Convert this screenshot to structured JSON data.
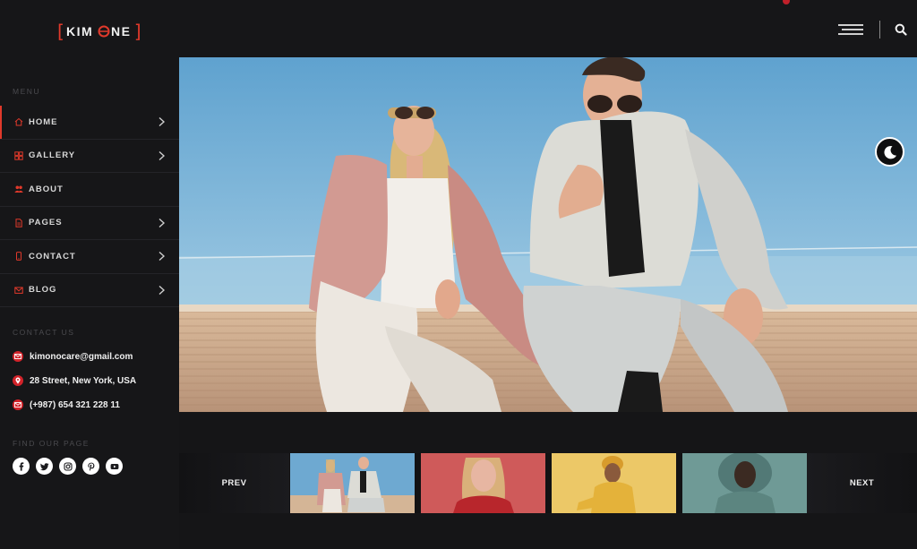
{
  "brand": {
    "logo_text": "KIMONE",
    "accent_color": "#e0392b"
  },
  "header": {
    "menu_icon": "hamburger-icon",
    "search_icon": "search-icon"
  },
  "sidebar": {
    "menu_title": "MENU",
    "items": [
      {
        "label": "HOME",
        "icon": "home-icon",
        "has_submenu": true,
        "active": true
      },
      {
        "label": "GALLERY",
        "icon": "gallery-icon",
        "has_submenu": true,
        "active": false
      },
      {
        "label": "ABOUT",
        "icon": "users-icon",
        "has_submenu": false,
        "active": false
      },
      {
        "label": "PAGES",
        "icon": "file-icon",
        "has_submenu": true,
        "active": false
      },
      {
        "label": "CONTACT",
        "icon": "phone-icon",
        "has_submenu": true,
        "active": false
      },
      {
        "label": "BLOG",
        "icon": "mail-icon",
        "has_submenu": true,
        "active": false
      }
    ],
    "contact_title": "CONTACT US",
    "contact": {
      "email": "kimonocare@gmail.com",
      "address": "28 Street, New York, USA",
      "phone": "(+987) 654 321 228 11"
    },
    "social_title": "FIND OUR PAGE",
    "socials": [
      "facebook-icon",
      "twitter-icon",
      "instagram-icon",
      "pinterest-icon",
      "youtube-icon"
    ]
  },
  "slider": {
    "prev_label": "PREV",
    "next_label": "NEXT",
    "thumbnails": [
      "couple-fashion-thumbnail",
      "red-portrait-thumbnail",
      "yellow-portrait-thumbnail",
      "teal-portrait-thumbnail"
    ]
  },
  "theme_toggle_icon": "moon-icon"
}
